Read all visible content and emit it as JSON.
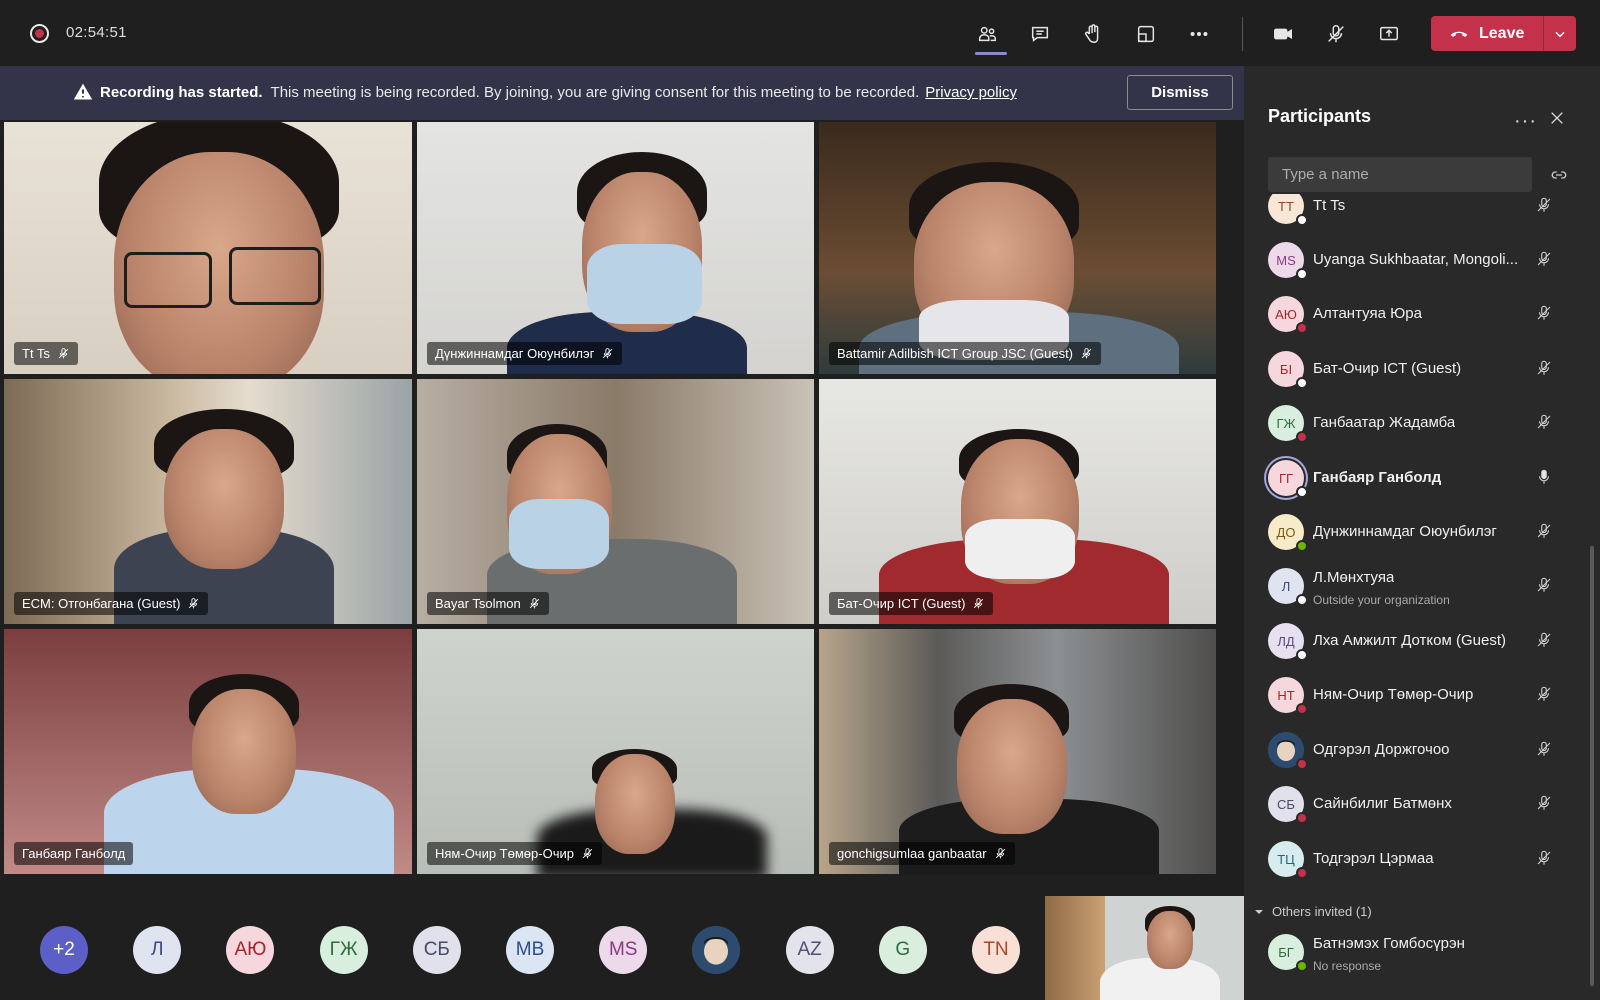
{
  "meeting": {
    "timer": "02:54:51"
  },
  "toolbar": {
    "items": [
      "participants-icon",
      "chat-icon",
      "raise-hand-icon",
      "rooms-icon",
      "more-icon",
      "camera-icon",
      "mic-muted-icon",
      "share-icon"
    ],
    "leave_label": "Leave",
    "leave_color": "#c4314b"
  },
  "banner": {
    "title": "Recording has started.",
    "message": "This meeting is being recorded. By joining, you are giving consent for this meeting to be recorded.",
    "link": "Privacy policy",
    "dismiss": "Dismiss"
  },
  "tiles": [
    {
      "name": "Tt Ts",
      "muted": true
    },
    {
      "name": "Дүнжиннамдаг Оюунбилэг",
      "muted": true
    },
    {
      "name": "Battamir Adilbish ICT Group JSC (Guest)",
      "muted": true
    },
    {
      "name": "ECM: Отгонбагана (Guest)",
      "muted": true
    },
    {
      "name": "Bayar Tsolmon",
      "muted": true
    },
    {
      "name": "Бат-Очир ICT (Guest)",
      "muted": true
    },
    {
      "name": "Ганбаяр Ганболд",
      "muted": false
    },
    {
      "name": "Ням-Очир Төмөр-Очир",
      "muted": true
    },
    {
      "name": "gonchigsumlaa ganbaatar",
      "muted": true
    }
  ],
  "strip": [
    {
      "label": "+2",
      "bg": "#5b5fc7",
      "fg": "#ffffff"
    },
    {
      "label": "Л",
      "bg": "#dfe4f0",
      "fg": "#3b4a79"
    },
    {
      "label": "АЮ",
      "bg": "#f6d7dd",
      "fg": "#a4262c"
    },
    {
      "label": "ГЖ",
      "bg": "#d8eede",
      "fg": "#2f6b3c"
    },
    {
      "label": "СБ",
      "bg": "#e0e1ea",
      "fg": "#474a6b"
    },
    {
      "label": "MB",
      "bg": "#dbe5f4",
      "fg": "#2b4f8a"
    },
    {
      "label": "MS",
      "bg": "#ecdaea",
      "fg": "#8a3a84"
    },
    {
      "label": "",
      "bg": "#2d4b6e",
      "fg": "#ffffff"
    },
    {
      "label": "AZ",
      "bg": "#e3e3ec",
      "fg": "#505070"
    },
    {
      "label": "G",
      "bg": "#d9eedd",
      "fg": "#2e6f3c"
    },
    {
      "label": "TN",
      "bg": "#f8e0d7",
      "fg": "#a8492c"
    }
  ],
  "participants": {
    "title": "Participants",
    "search_placeholder": "Type a name",
    "list": [
      {
        "initials": "TT",
        "name": "Tt Ts",
        "sub": "",
        "bg": "#f8e6d7",
        "fg": "#8a4a1e",
        "status": "#ffffff",
        "muted": true
      },
      {
        "initials": "MS",
        "name": "Uyanga Sukhbaatar, Mongoli...",
        "sub": "",
        "bg": "#ecdaea",
        "fg": "#8a3a84",
        "status": "#ffffff",
        "muted": true
      },
      {
        "initials": "АЮ",
        "name": "Алтантуяа Юра",
        "sub": "",
        "bg": "#f6d7dd",
        "fg": "#a4262c",
        "status": "#c4314b",
        "muted": true
      },
      {
        "initials": "БI",
        "name": "Бат-Очир ICT (Guest)",
        "sub": "",
        "bg": "#f6d7dd",
        "fg": "#a4262c",
        "status": "#ffffff",
        "muted": true
      },
      {
        "initials": "ГЖ",
        "name": "Ганбаатар Жадамба",
        "sub": "",
        "bg": "#d8eede",
        "fg": "#2f6b3c",
        "status": "#c4314b",
        "muted": true
      },
      {
        "initials": "ГГ",
        "name": "Ганбаяр Ганболд",
        "sub": "",
        "bg": "#f6d7dd",
        "fg": "#a4262c",
        "status": "#ffffff",
        "muted": false,
        "active": true
      },
      {
        "initials": "ДО",
        "name": "Дүнжиннамдаг Оюунбилэг",
        "sub": "",
        "bg": "#f6ecc9",
        "fg": "#7a5a12",
        "status": "#6bb700",
        "muted": true
      },
      {
        "initials": "Л",
        "name": "Л.Мөнхтуяа",
        "sub": "Outside your organization",
        "bg": "#dfe4f0",
        "fg": "#3b4a79",
        "status": "#ffffff",
        "muted": true
      },
      {
        "initials": "ЛД",
        "name": "Лха Амжилт Дотком (Guest)",
        "sub": "",
        "bg": "#e6e0ef",
        "fg": "#5b4a85",
        "status": "#ffffff",
        "muted": true
      },
      {
        "initials": "НТ",
        "name": "Ням-Очир Төмөр-Очир",
        "sub": "",
        "bg": "#f6d7dd",
        "fg": "#a4262c",
        "status": "#c4314b",
        "muted": true
      },
      {
        "initials": "",
        "name": "Одгэрэл Доржгочоо",
        "sub": "",
        "bg": "#2d4b6e",
        "fg": "#ffffff",
        "status": "#c4314b",
        "muted": true
      },
      {
        "initials": "СБ",
        "name": "Сайнбилиг Батмөнх",
        "sub": "",
        "bg": "#e0e1ea",
        "fg": "#474a6b",
        "status": "#c4314b",
        "muted": true
      },
      {
        "initials": "ТЦ",
        "name": "Тодгэрэл Цэрмаа",
        "sub": "",
        "bg": "#d6ecef",
        "fg": "#1f6a74",
        "status": "#c4314b",
        "muted": true
      }
    ],
    "others_label": "Others invited (1)",
    "invited": {
      "initials": "БГ",
      "name": "Батнэмэх Гомбосүрэн",
      "sub": "No response",
      "bg": "#d8eede",
      "fg": "#2f6b3c",
      "status": "#6bb700"
    }
  }
}
